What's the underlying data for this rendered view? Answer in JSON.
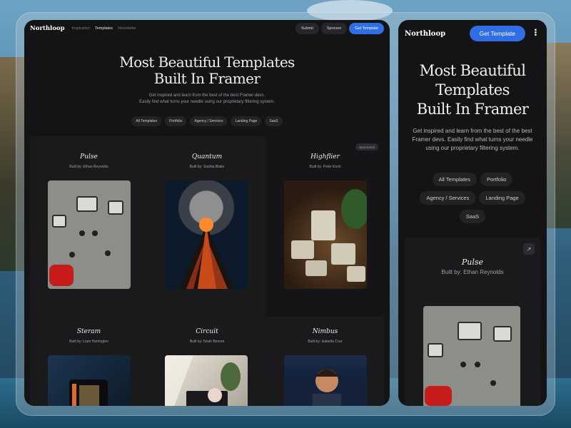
{
  "desktop": {
    "logo": "Northloop",
    "nav": [
      "Inspiration",
      "Templates",
      "Newsletter"
    ],
    "buttons": {
      "submit": "Submit",
      "sponsor": "Sponsor",
      "get": "Get Template"
    },
    "hero": {
      "title_line1": "Most Beautiful Templates",
      "title_line2": "Built In Framer",
      "sub_line1": "Get inspired and learn from the best of the best Framer devs.",
      "sub_line2": "Easily find what turns your needle using our proprietary filtering system."
    },
    "filters": [
      "All Templates",
      "Portfolio",
      "Agency / Services",
      "Landing Page",
      "SaaS"
    ],
    "cards": [
      {
        "title": "Pulse",
        "by": "Built by: Ethan Reynolds"
      },
      {
        "title": "Quantum",
        "by": "Built by: Sophia Blake"
      },
      {
        "title": "Highflier",
        "by": "Built by: Peter Konti",
        "badge": "Sponsored"
      },
      {
        "title": "Steram",
        "by": "Built by: Liam Harrington"
      },
      {
        "title": "Circuit",
        "by": "Built by: Noah Bennet"
      },
      {
        "title": "Nimbus",
        "by": "Built by: Isabella Cruz"
      }
    ]
  },
  "mobile": {
    "logo": "Northloop",
    "get": "Get Template",
    "menu_icon": "more-vertical-icon",
    "title_line1": "Most Beautiful",
    "title_line2": "Templates",
    "title_line3": "Built In Framer",
    "sub": "Get inspired and learn from the best of the best Framer devs. Easily find what turns your needle using our proprietary filtering system.",
    "filters": [
      "All Templates",
      "Portfolio",
      "Agency / Services",
      "Landing Page",
      "SaaS"
    ],
    "card": {
      "title": "Pulse",
      "by": "Built by: Ethan Reynolds",
      "icon": "external-link-icon"
    }
  },
  "colors": {
    "accent": "#2f6ee5",
    "bg": "#141416",
    "card": "#1a1a1d"
  }
}
